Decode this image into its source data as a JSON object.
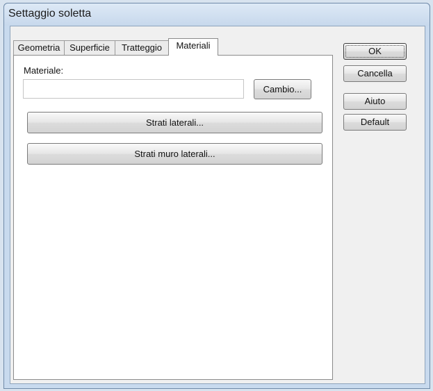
{
  "window": {
    "title": "Settaggio soletta"
  },
  "tabs": [
    {
      "label": "Geometria",
      "active": false
    },
    {
      "label": "Superficie",
      "active": false
    },
    {
      "label": "Tratteggio",
      "active": false
    },
    {
      "label": "Materiali",
      "active": true
    }
  ],
  "materials": {
    "material_label": "Materiale:",
    "material_value": "",
    "change_button": "Cambio...",
    "side_layers_button": "Strati laterali...",
    "wall_layers_button": "Strati muro laterali..."
  },
  "actions": {
    "ok": "OK",
    "cancel": "Cancella",
    "help": "Aiuto",
    "default": "Default"
  }
}
